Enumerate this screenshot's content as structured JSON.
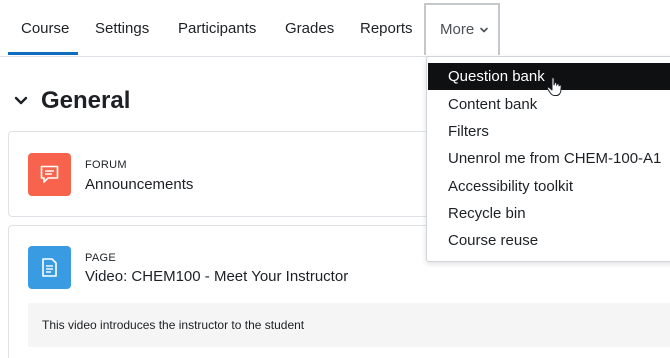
{
  "nav": {
    "tabs": [
      {
        "label": "Course"
      },
      {
        "label": "Settings"
      },
      {
        "label": "Participants"
      },
      {
        "label": "Grades"
      },
      {
        "label": "Reports"
      }
    ],
    "more_label": "More"
  },
  "section": {
    "title": "General"
  },
  "activities": [
    {
      "type": "FORUM",
      "name": "Announcements",
      "icon": "forum-icon",
      "color": "#f7634d"
    },
    {
      "type": "PAGE",
      "name": "Video: CHEM100 - Meet Your Instructor",
      "icon": "page-icon",
      "color": "#399be2",
      "description": "This video introduces the instructor to the student"
    }
  ],
  "more_menu": {
    "items": [
      {
        "label": "Question bank",
        "highlighted": true
      },
      {
        "label": "Content bank"
      },
      {
        "label": "Filters"
      },
      {
        "label": "Unenrol me from CHEM-100-A1"
      },
      {
        "label": "Accessibility toolkit"
      },
      {
        "label": "Recycle bin"
      },
      {
        "label": "Course reuse"
      }
    ]
  },
  "colors": {
    "active_tab_underline": "#0f6cbf",
    "menu_highlight": "#0f1012"
  }
}
